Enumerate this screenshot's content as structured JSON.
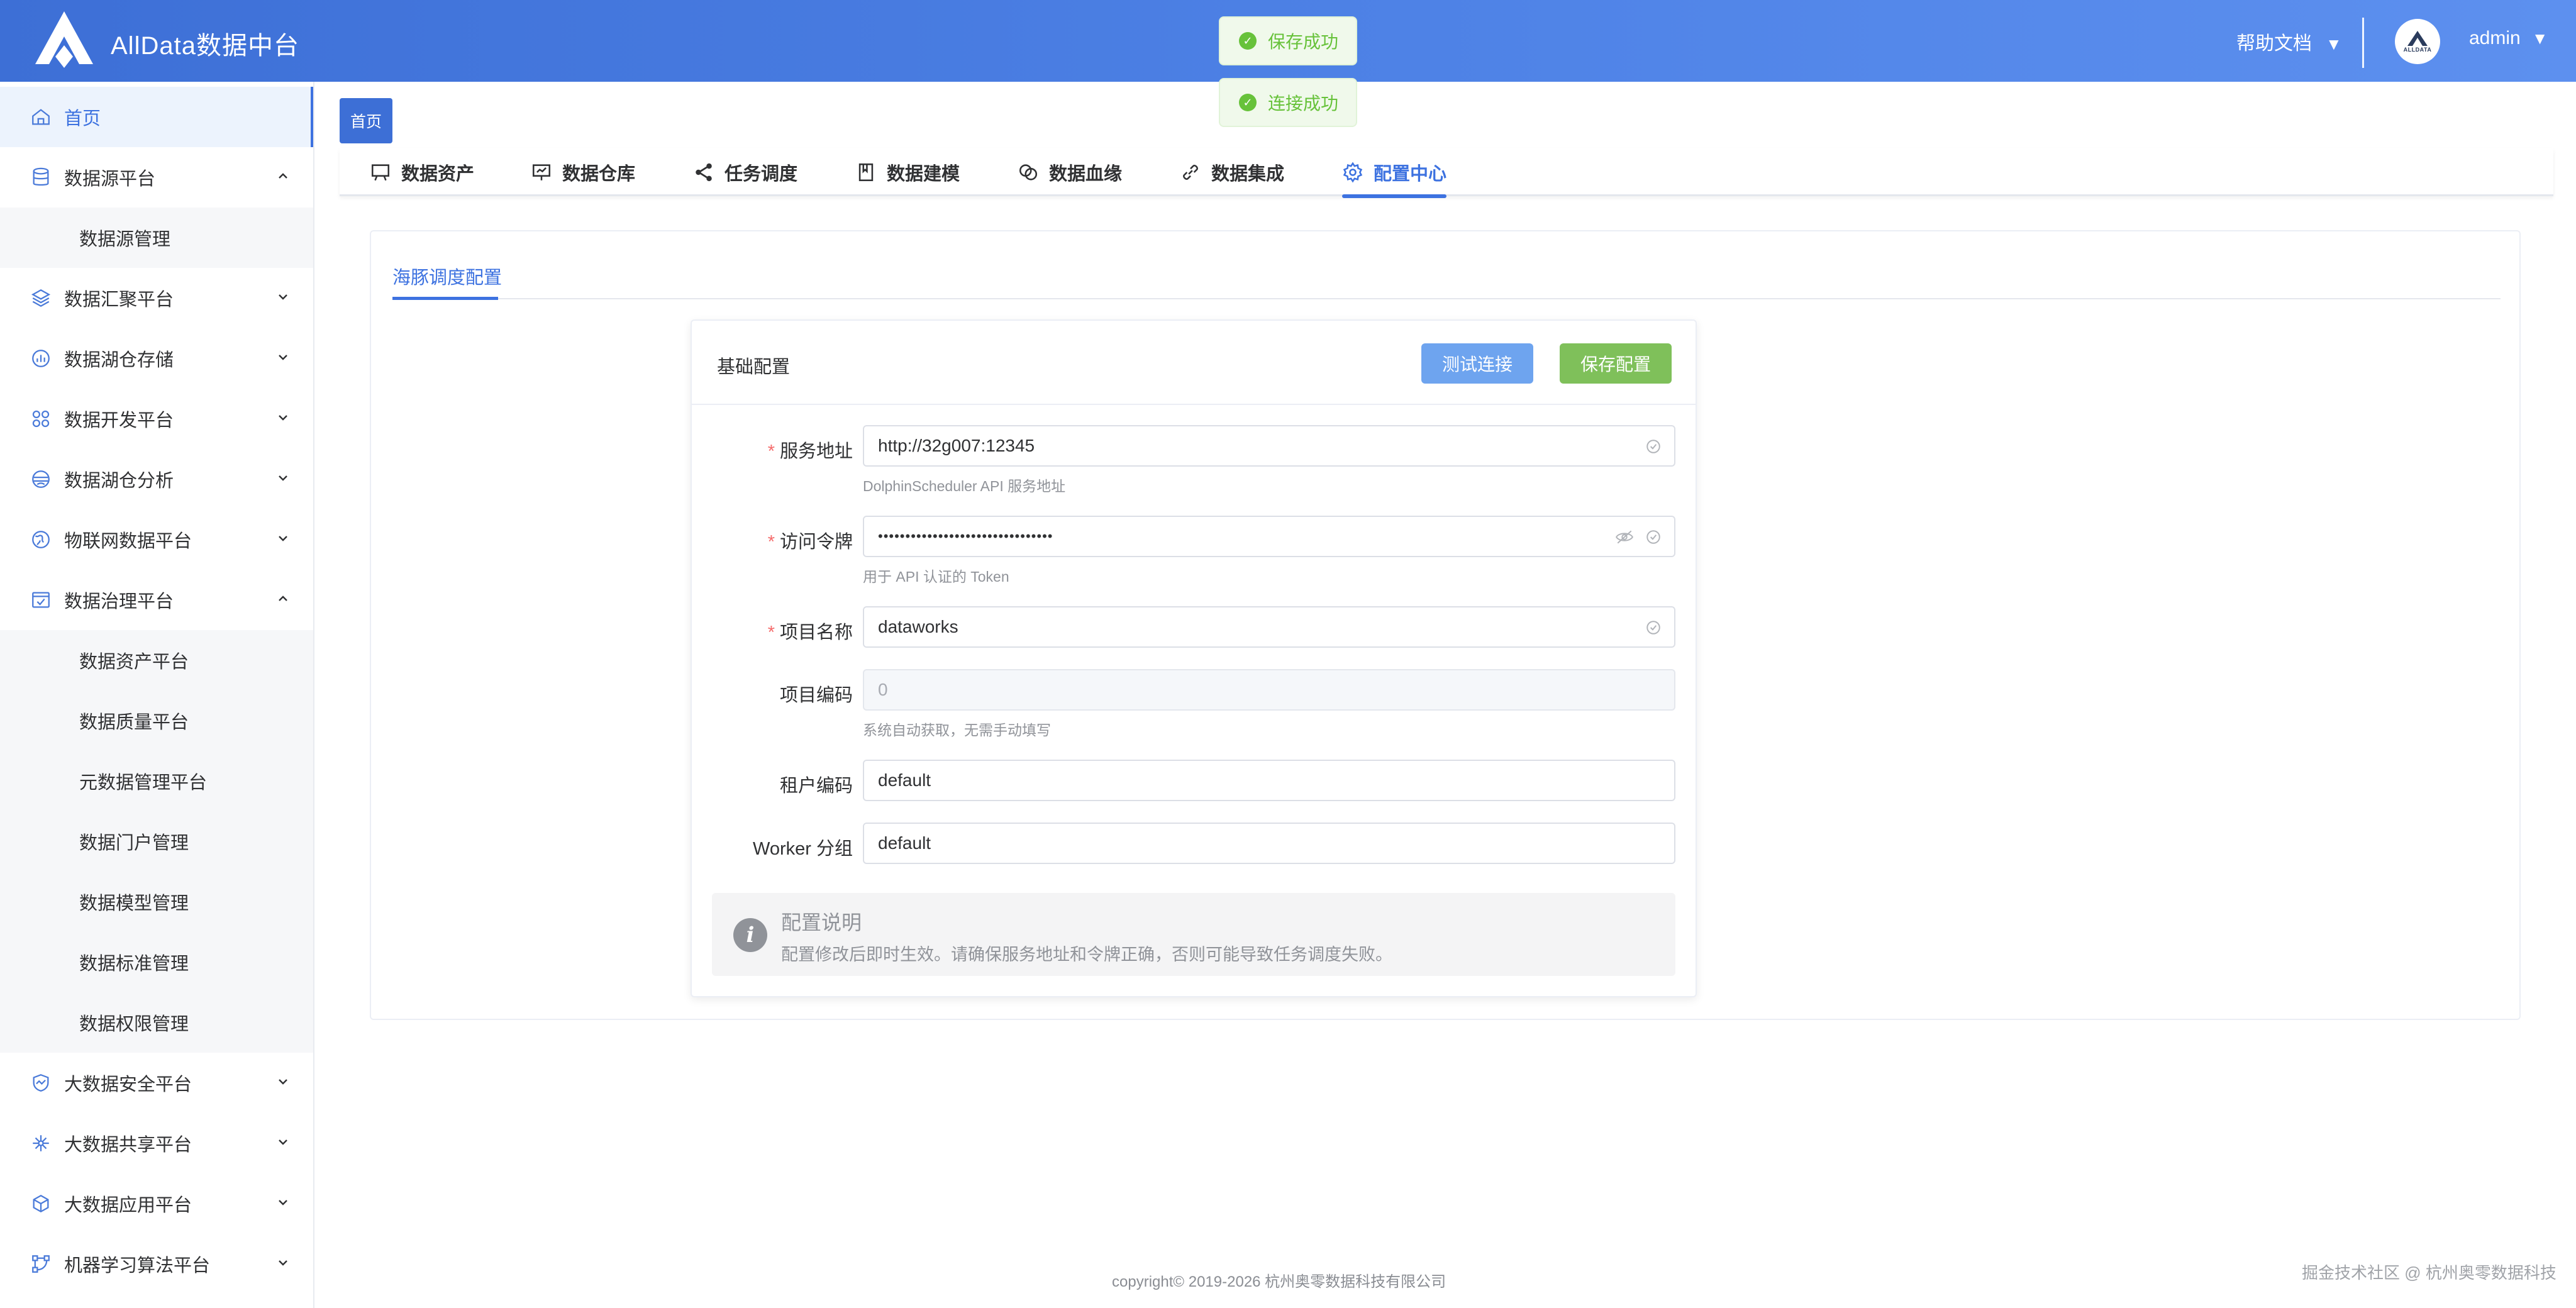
{
  "header": {
    "app_title": "AllData数据中台",
    "help_label": "帮助文档",
    "user_label": "admin",
    "avatar_text": "ALLDATA"
  },
  "toasts": {
    "save": "保存成功",
    "connect": "连接成功"
  },
  "sidebar": {
    "items": [
      {
        "label": "首页"
      },
      {
        "label": "数据源平台"
      },
      {
        "label": "数据源管理"
      },
      {
        "label": "数据汇聚平台"
      },
      {
        "label": "数据湖仓存储"
      },
      {
        "label": "数据开发平台"
      },
      {
        "label": "数据湖仓分析"
      },
      {
        "label": "物联网数据平台"
      },
      {
        "label": "数据治理平台"
      },
      {
        "label": "数据资产平台"
      },
      {
        "label": "数据质量平台"
      },
      {
        "label": "元数据管理平台"
      },
      {
        "label": "数据门户管理"
      },
      {
        "label": "数据模型管理"
      },
      {
        "label": "数据标准管理"
      },
      {
        "label": "数据权限管理"
      },
      {
        "label": "大数据安全平台"
      },
      {
        "label": "大数据共享平台"
      },
      {
        "label": "大数据应用平台"
      },
      {
        "label": "机器学习算法平台"
      }
    ]
  },
  "home_tag": "首页",
  "topnav": {
    "tabs": [
      {
        "label": "数据资产"
      },
      {
        "label": "数据仓库"
      },
      {
        "label": "任务调度"
      },
      {
        "label": "数据建模"
      },
      {
        "label": "数据血缘"
      },
      {
        "label": "数据集成"
      },
      {
        "label": "配置中心"
      }
    ]
  },
  "main": {
    "subtab": "海豚调度配置",
    "panel_title": "基础配置",
    "test_button": "测试连接",
    "save_button": "保存配置",
    "fields": [
      {
        "label": "服务地址",
        "value": "http://32g007:12345",
        "hint": "DolphinScheduler API 服务地址"
      },
      {
        "label": "访问令牌",
        "value": "••••••••••••••••••••••••••••••••",
        "hint": "用于 API 认证的 Token"
      },
      {
        "label": "项目名称",
        "value": "dataworks"
      },
      {
        "label": "项目编码",
        "placeholder": "0",
        "hint": "系统自动获取，无需手动填写"
      },
      {
        "label": "租户编码",
        "value": "default"
      },
      {
        "label": "Worker 分组",
        "value": "default"
      }
    ],
    "alert_title": "配置说明",
    "alert_desc": "配置修改后即时生效。请确保服务地址和令牌正确，否则可能导致任务调度失败。"
  },
  "footer": {
    "copyright": "copyright© 2019-2026 杭州奥零数据科技有限公司",
    "watermark": "掘金技术社区 @ 杭州奥零数据科技"
  },
  "colors": {
    "accent": "#3d72e0",
    "success": "#67c23a",
    "required": "#f56c6c"
  }
}
